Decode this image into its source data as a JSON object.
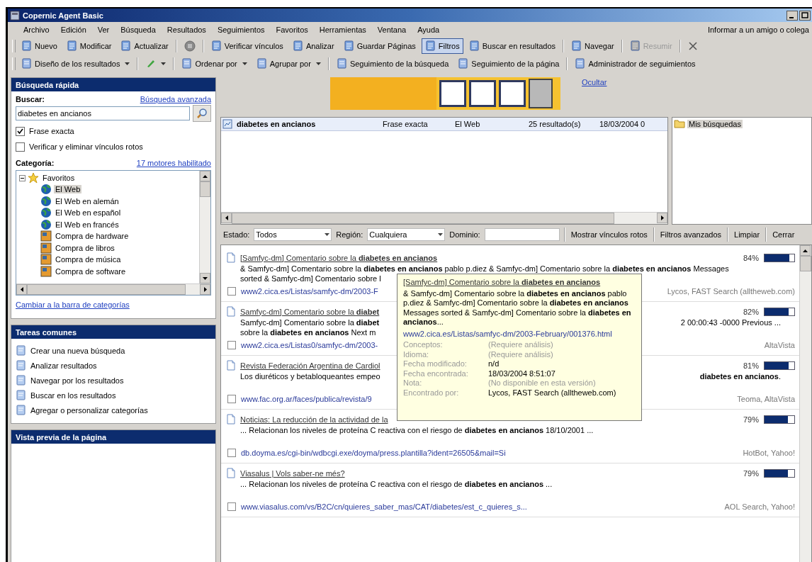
{
  "window": {
    "title": "Copernic Agent Basic"
  },
  "menu": {
    "items": [
      "Archivo",
      "Edición",
      "Ver",
      "Búsqueda",
      "Resultados",
      "Seguimientos",
      "Favoritos",
      "Herramientas",
      "Ventana",
      "Ayuda"
    ],
    "tell_friend": "Informar a un amigo o colega"
  },
  "toolbar_main": [
    {
      "kind": "button",
      "label": "Nuevo",
      "pressed": false,
      "disabled": false
    },
    {
      "kind": "button",
      "label": "Modificar",
      "pressed": false,
      "disabled": false
    },
    {
      "kind": "button",
      "label": "Actualizar",
      "pressed": false,
      "disabled": false
    },
    {
      "kind": "separator"
    },
    {
      "kind": "stop"
    },
    {
      "kind": "separator"
    },
    {
      "kind": "button",
      "label": "Verificar vínculos",
      "pressed": false,
      "disabled": false
    },
    {
      "kind": "button",
      "label": "Analizar",
      "pressed": false,
      "disabled": false
    },
    {
      "kind": "button",
      "label": "Guardar Páginas",
      "pressed": false,
      "disabled": false
    },
    {
      "kind": "button",
      "label": "Filtros",
      "pressed": true,
      "disabled": false
    },
    {
      "kind": "button",
      "label": "Buscar en resultados",
      "pressed": false,
      "disabled": false
    },
    {
      "kind": "separator"
    },
    {
      "kind": "button",
      "label": "Navegar",
      "pressed": false,
      "disabled": false
    },
    {
      "kind": "separator"
    },
    {
      "kind": "button",
      "label": "Resumir",
      "pressed": false,
      "disabled": true
    },
    {
      "kind": "separator"
    },
    {
      "kind": "close"
    }
  ],
  "toolbar_view": [
    {
      "kind": "button",
      "label": "Diseño de los resultados",
      "dropdown": true
    },
    {
      "kind": "separator"
    },
    {
      "kind": "icon",
      "dropdown": true
    },
    {
      "kind": "separator"
    },
    {
      "kind": "button",
      "label": "Ordenar por",
      "dropdown": true
    },
    {
      "kind": "button",
      "label": "Agrupar por",
      "dropdown": true
    },
    {
      "kind": "separator"
    },
    {
      "kind": "button",
      "label": "Seguimiento de la búsqueda",
      "dropdown": false
    },
    {
      "kind": "button",
      "label": "Seguimiento de la página",
      "dropdown": false
    },
    {
      "kind": "separator"
    },
    {
      "kind": "button",
      "label": "Administrador de seguimientos",
      "dropdown": false
    }
  ],
  "quick_search": {
    "title": "Búsqueda rápida",
    "search_label": "Buscar:",
    "advanced_link": "Búsqueda avanzada",
    "query": "diabetes en ancianos",
    "options": [
      {
        "label": "Frase exacta",
        "checked": true
      },
      {
        "label": "Verificar y eliminar vínculos rotos",
        "checked": false
      }
    ],
    "category_label": "Categoría:",
    "engines_link": "17 motores habilitado",
    "tree": {
      "label": "Favoritos",
      "expanded": true,
      "children": [
        {
          "label": "El Web",
          "kind": "web",
          "selected": true
        },
        {
          "label": "El Web en alemán",
          "kind": "web",
          "selected": false
        },
        {
          "label": "El Web en español",
          "kind": "web",
          "selected": false
        },
        {
          "label": "El Web en francés",
          "kind": "web",
          "selected": false
        },
        {
          "label": "Compra de hardware",
          "kind": "shop",
          "selected": false
        },
        {
          "label": "Compra de libros",
          "kind": "shop",
          "selected": false
        },
        {
          "label": "Compra de música",
          "kind": "shop",
          "selected": false
        },
        {
          "label": "Compra de software",
          "kind": "shop",
          "selected": false
        }
      ]
    },
    "switch_link": "Cambiar a la barra de categorías"
  },
  "common_tasks": {
    "title": "Tareas comunes",
    "items": [
      "Crear una nueva búsqueda",
      "Analizar resultados",
      "Navegar por los resultados",
      "Buscar en los resultados",
      "Agregar o personalizar categorías"
    ]
  },
  "preview": {
    "title": "Vista previa de la página"
  },
  "ad": {
    "hide_link": "Ocultar"
  },
  "searches": {
    "rows": [
      {
        "query": "diabetes en ancianos",
        "type": "Frase exacta",
        "category": "El Web",
        "results": "25 resultado(s)",
        "date": "18/03/2004 0",
        "selected": true
      }
    ],
    "folders": [
      {
        "label": "Mis búsquedas",
        "selected": true
      }
    ]
  },
  "filters": {
    "status_label": "Estado:",
    "status": "Todos",
    "region_label": "Región:",
    "region": "Cualquiera",
    "domain_label": "Dominio:",
    "buttons": [
      "Mostrar vínculos rotos",
      "Filtros avanzados",
      "Limpiar",
      "Cerrar"
    ]
  },
  "results": [
    {
      "title": "[Samfyc-dm] Comentario sobre la **diabetes en ancianos**",
      "score": "84%",
      "level": 0.84,
      "snippet": [
        {
          "text": "& Samfyc-dm] Comentario sobre la **diabetes en ancianos** pablo p.diez & Samfyc-dm] Comentario sobre la **diabetes en ancianos** Messages"
        },
        {
          "text": "sorted & Samfyc-dm] Comentario sobre l"
        }
      ],
      "url": "www2.cica.es/Listas/samfyc-dm/2003-F",
      "checked": false,
      "engines": "Lycos, FAST Search (alltheweb.com)"
    },
    {
      "title": "Samfyc-dm] Comentario sobre la **diabet**",
      "score": "82%",
      "level": 0.82,
      "snippet": [
        {
          "text": "Samfyc-dm] Comentario sobre la **diabet**",
          "tail": "2 00:00:43 -0000 Previous ..."
        },
        {
          "text": "sobre la **diabetes en ancianos** Next m"
        }
      ],
      "url": "www2.cica.es/Listas0/samfyc-dm/2003-",
      "checked": false,
      "engines": "AltaVista"
    },
    {
      "title": "Revista Federación Argentina de Cardiol",
      "score": "81%",
      "level": 0.81,
      "snippet": [
        {
          "text": "Los diuréticos y betabloqueantes empeo",
          "tail": "**diabetes en ancianos**."
        }
      ],
      "url": "www.fac.org.ar/faces/publica/revista/9",
      "checked": false,
      "engines": "Teoma, AltaVista"
    },
    {
      "title": "Noticias: La reducción de la actividad de la",
      "score": "79%",
      "level": 0.79,
      "snippet": [
        {
          "text": "... Relacionan los niveles de proteína C reactiva con el riesgo de **diabetes en ancianos** 18/10/2001 ..."
        }
      ],
      "url": "db.doyma.es/cgi-bin/wdbcgi.exe/doyma/press.plantilla?ident=26505&mail=Si",
      "checked": false,
      "engines": "HotBot, Yahoo!"
    },
    {
      "title": "Viasalus | Vols saber-ne més?",
      "score": "79%",
      "level": 0.79,
      "snippet": [
        {
          "text": "... Relacionan los niveles de proteína C reactiva con el riesgo de **diabetes en ancianos** ..."
        }
      ],
      "url": "www.viasalus.com/vs/B2C/cn/quieres_saber_mas/CAT/diabetes/est_c_quieres_s...",
      "checked": false,
      "engines": "AOL Search, Yahoo!"
    }
  ],
  "tooltip": {
    "title": "[Samfyc-dm] Comentario sobre la **diabetes en ancianos**",
    "text": "& Samfyc-dm] Comentario sobre la **diabetes en ancianos** pablo p.diez & Samfyc-dm] Comentario sobre la **diabetes en ancianos** Messages sorted & Samfyc-dm] Comentario sobre la **diabetes en ancianos**...",
    "url": "www2.cica.es/Listas/samfyc-dm/2003-February/001376.html",
    "fields": [
      {
        "label": "Conceptos:",
        "value": "(Requiere análisis)",
        "muted": true
      },
      {
        "label": "Idioma:",
        "value": "(Requiere análisis)",
        "muted": true
      },
      {
        "label": "Fecha modificado:",
        "value": "n/d",
        "muted": false
      },
      {
        "label": "Fecha encontrada:",
        "value": "18/03/2004 8:51:07",
        "muted": false
      },
      {
        "label": "Nota:",
        "value": "(No disponible en esta versión)",
        "muted": true
      },
      {
        "label": "Encontrado por:",
        "value": "Lycos, FAST Search (alltheweb.com)",
        "muted": false
      }
    ]
  }
}
